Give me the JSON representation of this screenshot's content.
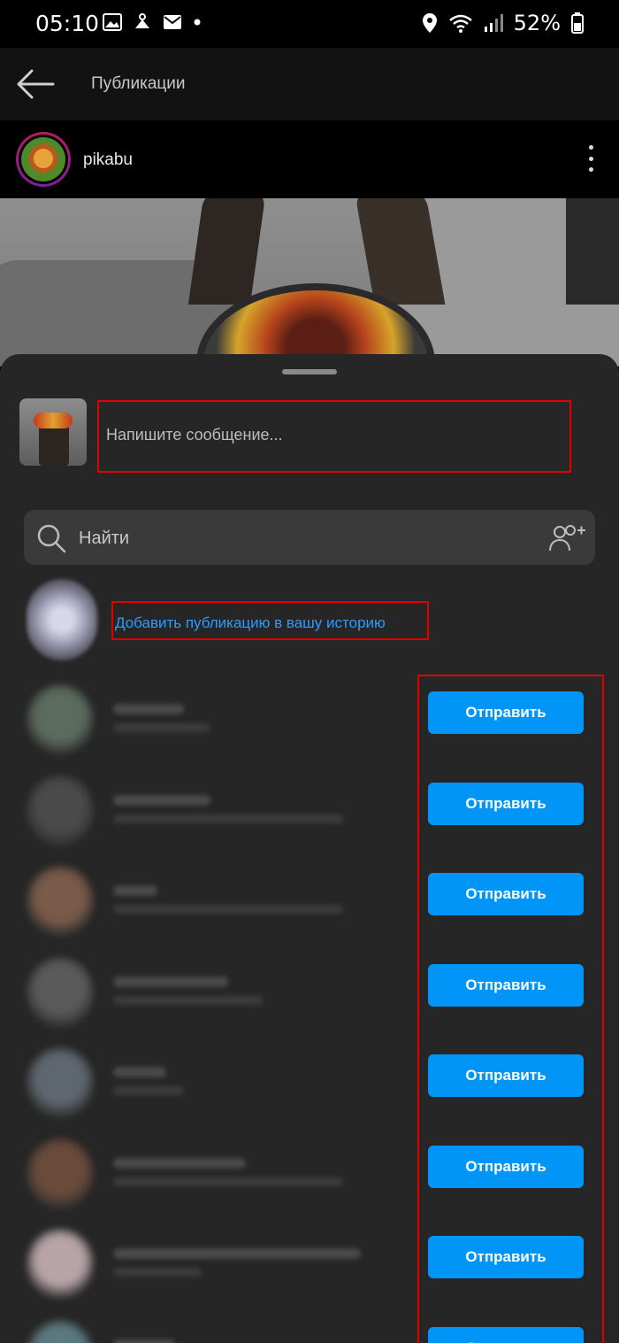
{
  "status_bar": {
    "time": "05:10",
    "battery": "52%",
    "icons_left": [
      "image-icon",
      "hanger-icon",
      "mail-icon",
      "dot-icon"
    ],
    "icons_right": [
      "location-icon",
      "wifi-icon",
      "signal-icon",
      "battery-icon"
    ]
  },
  "header": {
    "title": "Публикации",
    "back_icon": "arrow-left-icon"
  },
  "post": {
    "username": "pikabu",
    "more_icon": "more-vertical-icon"
  },
  "share_sheet": {
    "message_placeholder": "Напишите сообщение...",
    "search_placeholder": "Найти",
    "add_to_story": "Добавить публикацию в вашу историю",
    "send_label": "Отправить",
    "contacts": [
      {
        "avatar_color": "#5b6b5e"
      },
      {
        "avatar_color": "#4a4a4a"
      },
      {
        "avatar_color": "#7a5a48"
      },
      {
        "avatar_color": "#5a5a5a"
      },
      {
        "avatar_color": "#5e6670"
      },
      {
        "avatar_color": "#6a4a3a"
      },
      {
        "avatar_color": "#b8a4a8"
      },
      {
        "avatar_color": "#5a7a80"
      }
    ]
  },
  "colors": {
    "accent": "#0095f6",
    "link": "#2f9bff",
    "sheet_bg": "#262626",
    "highlight_box": "#e00000"
  }
}
